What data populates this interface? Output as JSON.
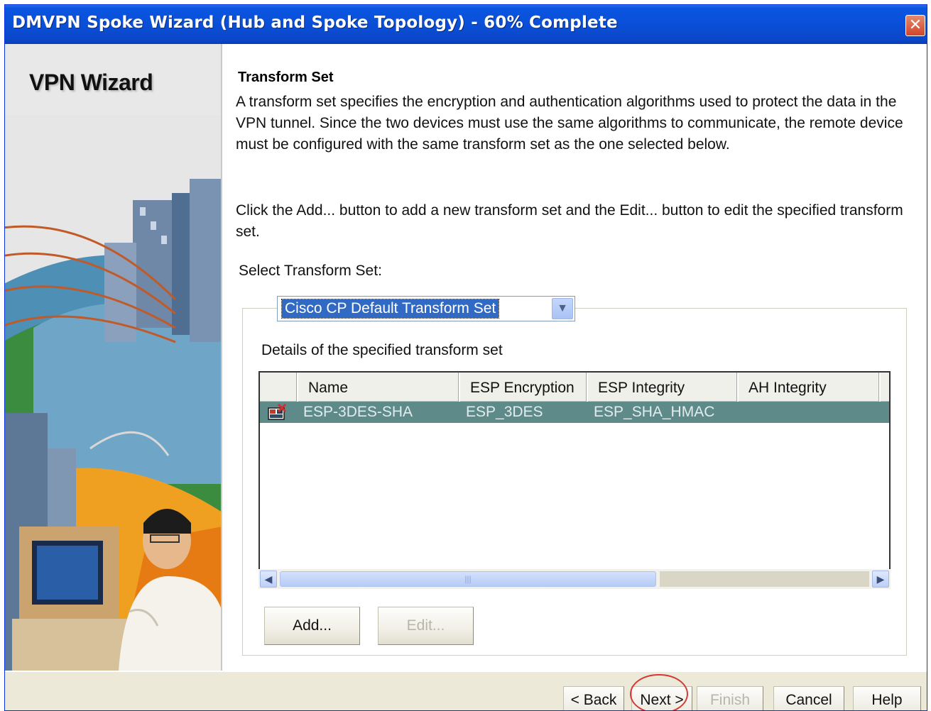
{
  "window": {
    "title": "DMVPN Spoke Wizard (Hub and Spoke Topology) - 60% Complete",
    "progress_percent": 60,
    "close_glyph": "✕"
  },
  "side_panel": {
    "title": "VPN Wizard"
  },
  "main": {
    "section_title": "Transform Set",
    "description": "A transform set specifies the encryption and authentication algorithms used to protect the data in the VPN tunnel. Since the two devices must use the same algorithms to communicate, the remote device must be configured with the same transform set as the one selected below.",
    "instructions": "Click the Add... button to add a new transform set and the Edit... button to edit the specified transform set.",
    "select_label": "Select Transform Set:",
    "selected_transform_set": "Cisco CP Default Transform Set",
    "details_label": "Details of the specified transform set",
    "table": {
      "columns": [
        "Name",
        "ESP Encryption",
        "ESP Integrity",
        "AH Integrity"
      ],
      "rows": [
        {
          "name": "ESP-3DES-SHA",
          "esp_encryption": "ESP_3DES",
          "esp_integrity": "ESP_SHA_HMAC",
          "ah_integrity": ""
        }
      ]
    },
    "buttons": {
      "add": "Add...",
      "edit": "Edit..."
    }
  },
  "footer": {
    "back": "< Back",
    "next": "Next >",
    "finish": "Finish",
    "cancel": "Cancel",
    "help": "Help"
  },
  "colors": {
    "title_bar": "#0a4fd8",
    "selection": "#316ac5",
    "table_row_selected": "#5f8a8a",
    "highlight_circle": "#d43a32"
  }
}
